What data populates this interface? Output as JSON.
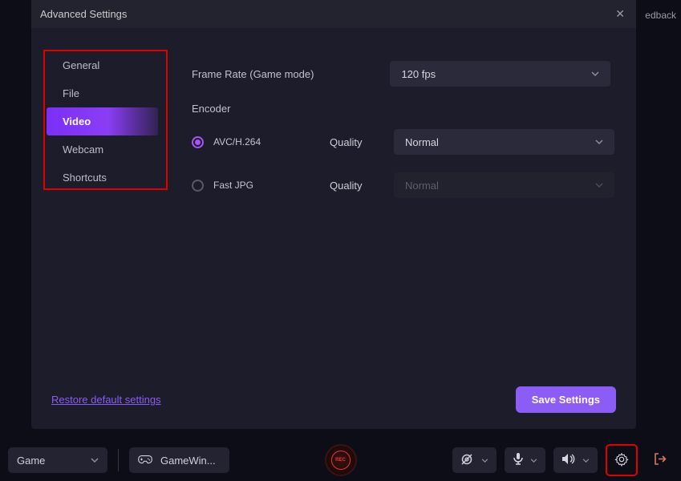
{
  "feedback": "edback",
  "modal": {
    "title": "Advanced Settings"
  },
  "sidebar": {
    "items": [
      {
        "label": "General"
      },
      {
        "label": "File"
      },
      {
        "label": "Video"
      },
      {
        "label": "Webcam"
      },
      {
        "label": "Shortcuts"
      }
    ]
  },
  "content": {
    "frameRateLabel": "Frame Rate (Game mode)",
    "frameRateValue": "120 fps",
    "encoderLabel": "Encoder",
    "encoder1": {
      "name": "AVC/H.264",
      "qualityLabel": "Quality",
      "qualityValue": "Normal"
    },
    "encoder2": {
      "name": "Fast JPG",
      "qualityLabel": "Quality",
      "qualityValue": "Normal"
    }
  },
  "footer": {
    "restore": "Restore default settings",
    "save": "Save Settings"
  },
  "bottomBar": {
    "modeValue": "Game",
    "targetValue": "GameWin...",
    "recLabel": "REC"
  }
}
